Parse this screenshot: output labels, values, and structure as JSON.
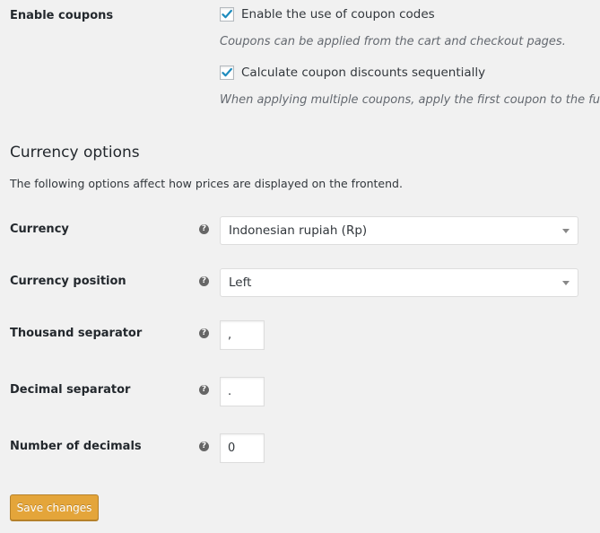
{
  "coupons": {
    "label": "Enable coupons",
    "enable": {
      "checked": true,
      "label": "Enable the use of coupon codes",
      "description": "Coupons can be applied from the cart and checkout pages."
    },
    "sequential": {
      "checked": true,
      "label": "Calculate coupon discounts sequentially",
      "description": "When applying multiple coupons, apply the first coupon to the full pric"
    }
  },
  "currency_options": {
    "title": "Currency options",
    "description": "The following options affect how prices are displayed on the frontend.",
    "help_glyph": "?",
    "currency": {
      "label": "Currency",
      "selected": "Indonesian rupiah (Rp)"
    },
    "currency_position": {
      "label": "Currency position",
      "selected": "Left"
    },
    "thousand_separator": {
      "label": "Thousand separator",
      "value": ","
    },
    "decimal_separator": {
      "label": "Decimal separator",
      "value": "."
    },
    "number_of_decimals": {
      "label": "Number of decimals",
      "value": "0"
    }
  },
  "save_button": {
    "label": "Save changes"
  },
  "colors": {
    "accent": "#e4a53a",
    "checkmark": "#1e8cbe",
    "background": "#f1f1f1"
  }
}
